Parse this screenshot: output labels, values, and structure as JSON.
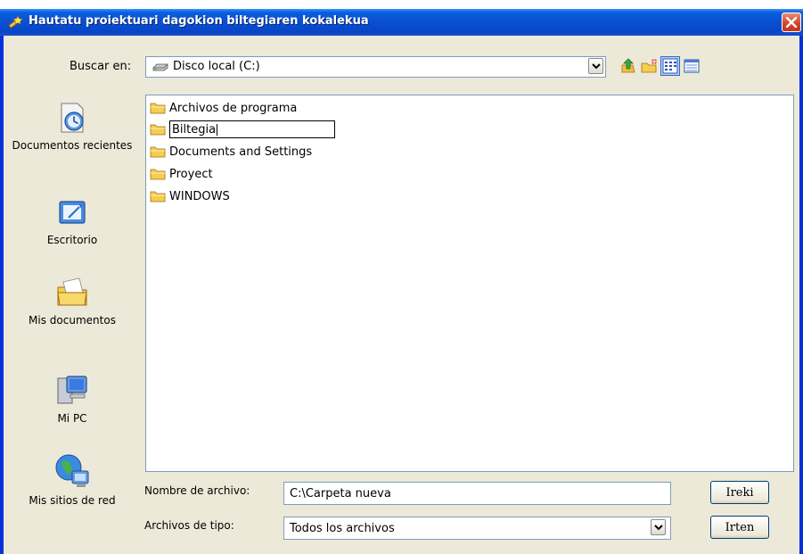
{
  "window": {
    "title": "Hautatu proiektuari dagokion biltegiaren kokalekua"
  },
  "look_in": {
    "label": "Buscar en:",
    "value": "Disco local (C:)"
  },
  "toolbar": {
    "icons": [
      "up-folder-icon",
      "new-folder-icon",
      "view-list-icon",
      "view-details-icon"
    ]
  },
  "places_bar": {
    "items": [
      {
        "label": "Documentos recientes",
        "icon": "recent-documents-icon"
      },
      {
        "label": "Escritorio",
        "icon": "desktop-icon"
      },
      {
        "label": "Mis documentos",
        "icon": "my-documents-icon"
      },
      {
        "label": "Mi PC",
        "icon": "my-computer-icon"
      },
      {
        "label": "Mis sitios de red",
        "icon": "network-places-icon"
      }
    ]
  },
  "file_list": {
    "items": [
      {
        "name": "Archivos de programa"
      },
      {
        "name": "Biltegia"
      },
      {
        "name": "Documents and Settings"
      },
      {
        "name": "Proyect"
      },
      {
        "name": "WINDOWS"
      }
    ]
  },
  "filename": {
    "label": "Nombre de archivo:",
    "value": "C:\\Carpeta nueva"
  },
  "filetype": {
    "label": "Archivos de tipo:",
    "value": "Todos los archivos"
  },
  "buttons": {
    "open": "Ireki",
    "cancel": "Irten"
  },
  "colors": {
    "titlebar": "#0a4fd0",
    "dialog_bg": "#ece9d8",
    "close_button": "#d2462a",
    "field_border": "#7f9db9"
  }
}
